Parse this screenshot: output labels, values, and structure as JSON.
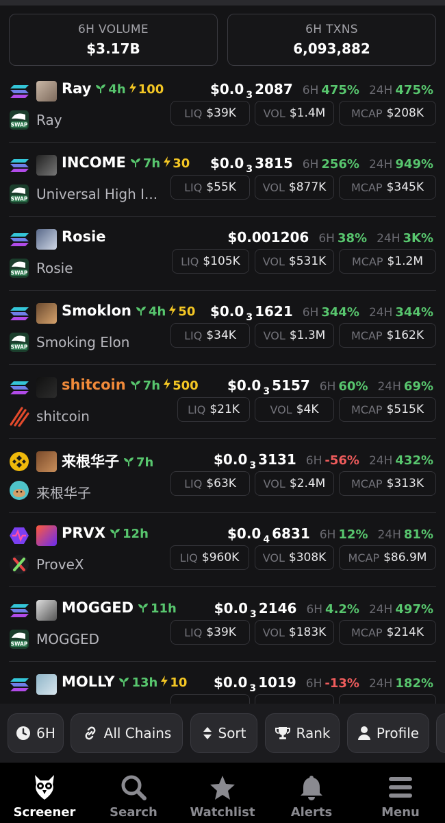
{
  "stats": {
    "volume": {
      "label": "6H VOLUME",
      "value": "$3.17B"
    },
    "txns": {
      "label": "6H TXNS",
      "value": "6,093,882"
    }
  },
  "colors": {
    "up": "#58c66e",
    "down": "#ef5c5c",
    "boost": "#f3c624",
    "accent_name": "#f08a3a"
  },
  "rows": [
    {
      "chain": "solana",
      "dex": "raydium-swap",
      "name": "Ray",
      "age": "4h",
      "boost": "100",
      "fullname": "Ray",
      "price_pre": "$0.0",
      "price_sub": "3",
      "price_post": "2087",
      "h6_label": "6H",
      "h6": "475%",
      "h6_dir": "up",
      "h24_label": "24H",
      "h24": "475%",
      "h24_dir": "up",
      "liq_label": "LIQ",
      "liq": "$39K",
      "vol_label": "VOL",
      "vol": "$1.4M",
      "mcap_label": "MCAP",
      "mcap": "$208K"
    },
    {
      "chain": "solana",
      "dex": "raydium-swap",
      "name": "INCOME",
      "age": "7h",
      "boost": "30",
      "fullname": "Universal High I...",
      "price_pre": "$0.0",
      "price_sub": "3",
      "price_post": "3815",
      "h6_label": "6H",
      "h6": "256%",
      "h6_dir": "up",
      "h24_label": "24H",
      "h24": "949%",
      "h24_dir": "up",
      "liq_label": "LIQ",
      "liq": "$55K",
      "vol_label": "VOL",
      "vol": "$877K",
      "mcap_label": "MCAP",
      "mcap": "$345K"
    },
    {
      "chain": "solana",
      "dex": "raydium-swap",
      "name": "Rosie",
      "age": "",
      "boost": "",
      "fullname": "Rosie",
      "price_pre": "$0.001206",
      "price_sub": "",
      "price_post": "",
      "h6_label": "6H",
      "h6": "38%",
      "h6_dir": "up",
      "h24_label": "24H",
      "h24": "3K%",
      "h24_dir": "up",
      "liq_label": "LIQ",
      "liq": "$105K",
      "vol_label": "VOL",
      "vol": "$531K",
      "mcap_label": "MCAP",
      "mcap": "$1.2M"
    },
    {
      "chain": "solana",
      "dex": "raydium-swap",
      "name": "Smoklon",
      "age": "4h",
      "boost": "50",
      "fullname": "Smoking Elon",
      "price_pre": "$0.0",
      "price_sub": "3",
      "price_post": "1621",
      "h6_label": "6H",
      "h6": "344%",
      "h6_dir": "up",
      "h24_label": "24H",
      "h24": "344%",
      "h24_dir": "up",
      "liq_label": "LIQ",
      "liq": "$34K",
      "vol_label": "VOL",
      "vol": "$1.3M",
      "mcap_label": "MCAP",
      "mcap": "$162K"
    },
    {
      "chain": "solana",
      "dex": "pump-stripes",
      "name": "shitcoin",
      "age": "7h",
      "boost": "500",
      "fullname": "shitcoin",
      "price_pre": "$0.0",
      "price_sub": "3",
      "price_post": "5157",
      "h6_label": "6H",
      "h6": "60%",
      "h6_dir": "up",
      "h24_label": "24H",
      "h24": "69%",
      "h24_dir": "up",
      "liq_label": "LIQ",
      "liq": "$21K",
      "vol_label": "VOL",
      "vol": "$4K",
      "mcap_label": "MCAP",
      "mcap": "$515K",
      "name_orange": true
    },
    {
      "chain": "bnb",
      "dex": "pancake",
      "name": "来根华子",
      "age": "7h",
      "boost": "",
      "fullname": "来根华子",
      "price_pre": "$0.0",
      "price_sub": "3",
      "price_post": "3131",
      "h6_label": "6H",
      "h6": "-56%",
      "h6_dir": "down",
      "h24_label": "24H",
      "h24": "432%",
      "h24_dir": "up",
      "liq_label": "LIQ",
      "liq": "$63K",
      "vol_label": "VOL",
      "vol": "$2.4M",
      "mcap_label": "MCAP",
      "mcap": "$313K"
    },
    {
      "chain": "hex-pulse",
      "dex": "x-green",
      "name": "PRVX",
      "age": "12h",
      "boost": "",
      "fullname": "ProveX",
      "price_pre": "$0.0",
      "price_sub": "4",
      "price_post": "6831",
      "h6_label": "6H",
      "h6": "12%",
      "h6_dir": "up",
      "h24_label": "24H",
      "h24": "81%",
      "h24_dir": "up",
      "liq_label": "LIQ",
      "liq": "$960K",
      "vol_label": "VOL",
      "vol": "$308K",
      "mcap_label": "MCAP",
      "mcap": "$86.9M"
    },
    {
      "chain": "solana",
      "dex": "raydium-swap",
      "name": "MOGGED",
      "age": "11h",
      "boost": "",
      "fullname": "MOGGED",
      "price_pre": "$0.0",
      "price_sub": "3",
      "price_post": "2146",
      "h6_label": "6H",
      "h6": "4.2%",
      "h6_dir": "up",
      "h24_label": "24H",
      "h24": "497%",
      "h24_dir": "up",
      "liq_label": "LIQ",
      "liq": "$39K",
      "vol_label": "VOL",
      "vol": "$183K",
      "mcap_label": "MCAP",
      "mcap": "$214K"
    },
    {
      "chain": "solana",
      "dex": "raydium-swap",
      "name": "MOLLY",
      "age": "13h",
      "boost": "10",
      "fullname": "",
      "price_pre": "$0.0",
      "price_sub": "3",
      "price_post": "1019",
      "h6_label": "6H",
      "h6": "-13%",
      "h6_dir": "down",
      "h24_label": "24H",
      "h24": "182%",
      "h24_dir": "up",
      "liq_label": "",
      "liq": "",
      "vol_label": "",
      "vol": "",
      "mcap_label": "",
      "mcap": ""
    }
  ],
  "filters": {
    "timeframe": "6H",
    "chains": "All Chains",
    "sort": "Sort",
    "rank": "Rank",
    "profile": "Profile"
  },
  "tabs": [
    {
      "label": "Screener",
      "icon": "owl-icon",
      "active": true
    },
    {
      "label": "Search",
      "icon": "search-icon",
      "active": false
    },
    {
      "label": "Watchlist",
      "icon": "star-icon",
      "active": false
    },
    {
      "label": "Alerts",
      "icon": "bell-icon",
      "active": false
    },
    {
      "label": "Menu",
      "icon": "menu-icon",
      "active": false
    }
  ]
}
